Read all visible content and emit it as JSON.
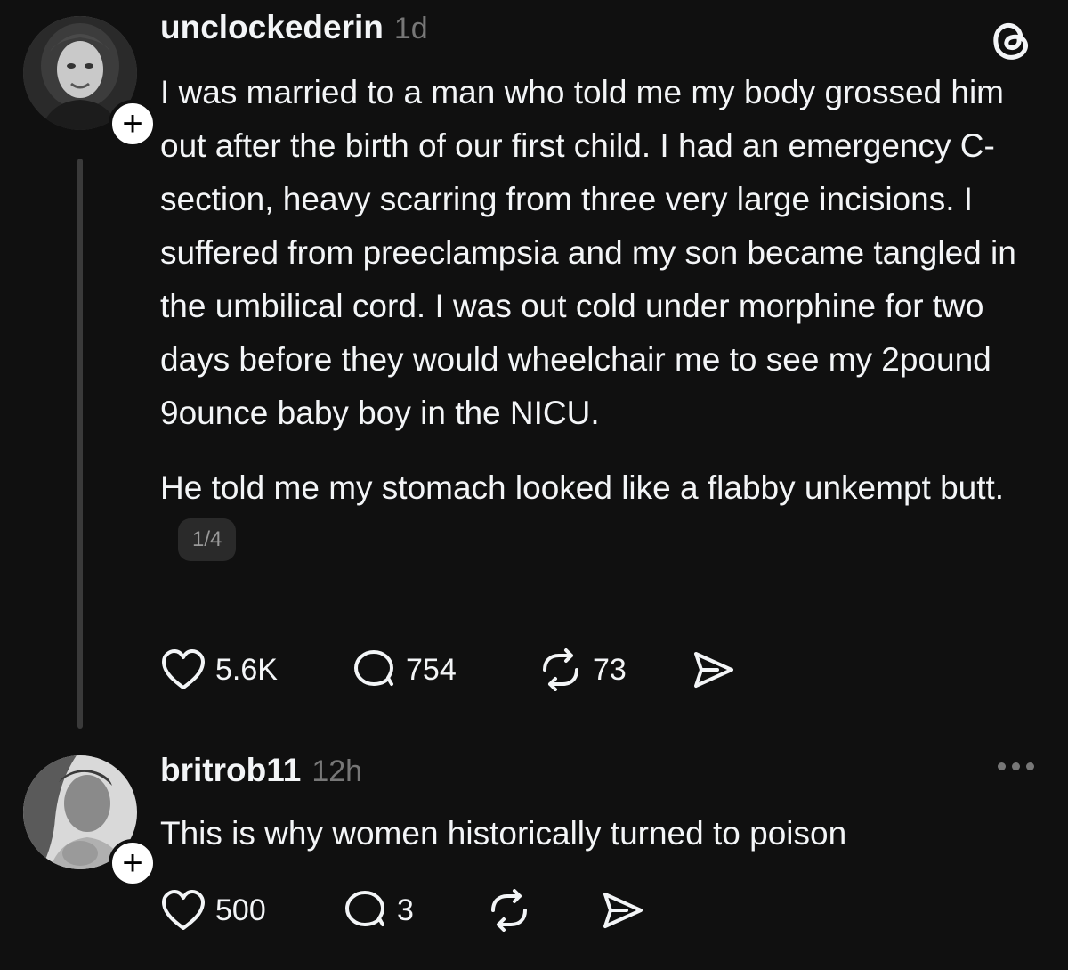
{
  "posts": [
    {
      "username": "unclockederin",
      "time": "1d",
      "paragraphs": [
        "I was married to a man who told me my body grossed him out after the birth of our first child. I had an emergency C-section, heavy scarring from three very large incisions. I suffered from preeclampsia and my son became tangled in the umbilical cord. I was out cold under morphine for two days before they would wheelchair me to see my 2pound 9ounce baby boy in the NICU.",
        "He told me my stomach looked like a flabby unkempt butt."
      ],
      "page_indicator": "1/4",
      "actions": {
        "likes": "5.6K",
        "comments": "754",
        "reposts": "73"
      },
      "follow_badge": "+",
      "corner_icon": "threads-logo-icon"
    },
    {
      "username": "britrob11",
      "time": "12h",
      "paragraphs": [
        "This is why women historically turned to poison"
      ],
      "actions": {
        "likes": "500",
        "comments": "3",
        "reposts": ""
      },
      "follow_badge": "+",
      "corner_icon": "more-icon"
    }
  ],
  "colors": {
    "background": "#101010",
    "text": "#f3f5f7",
    "muted": "#777777",
    "thread_line": "#3a3a3a"
  }
}
